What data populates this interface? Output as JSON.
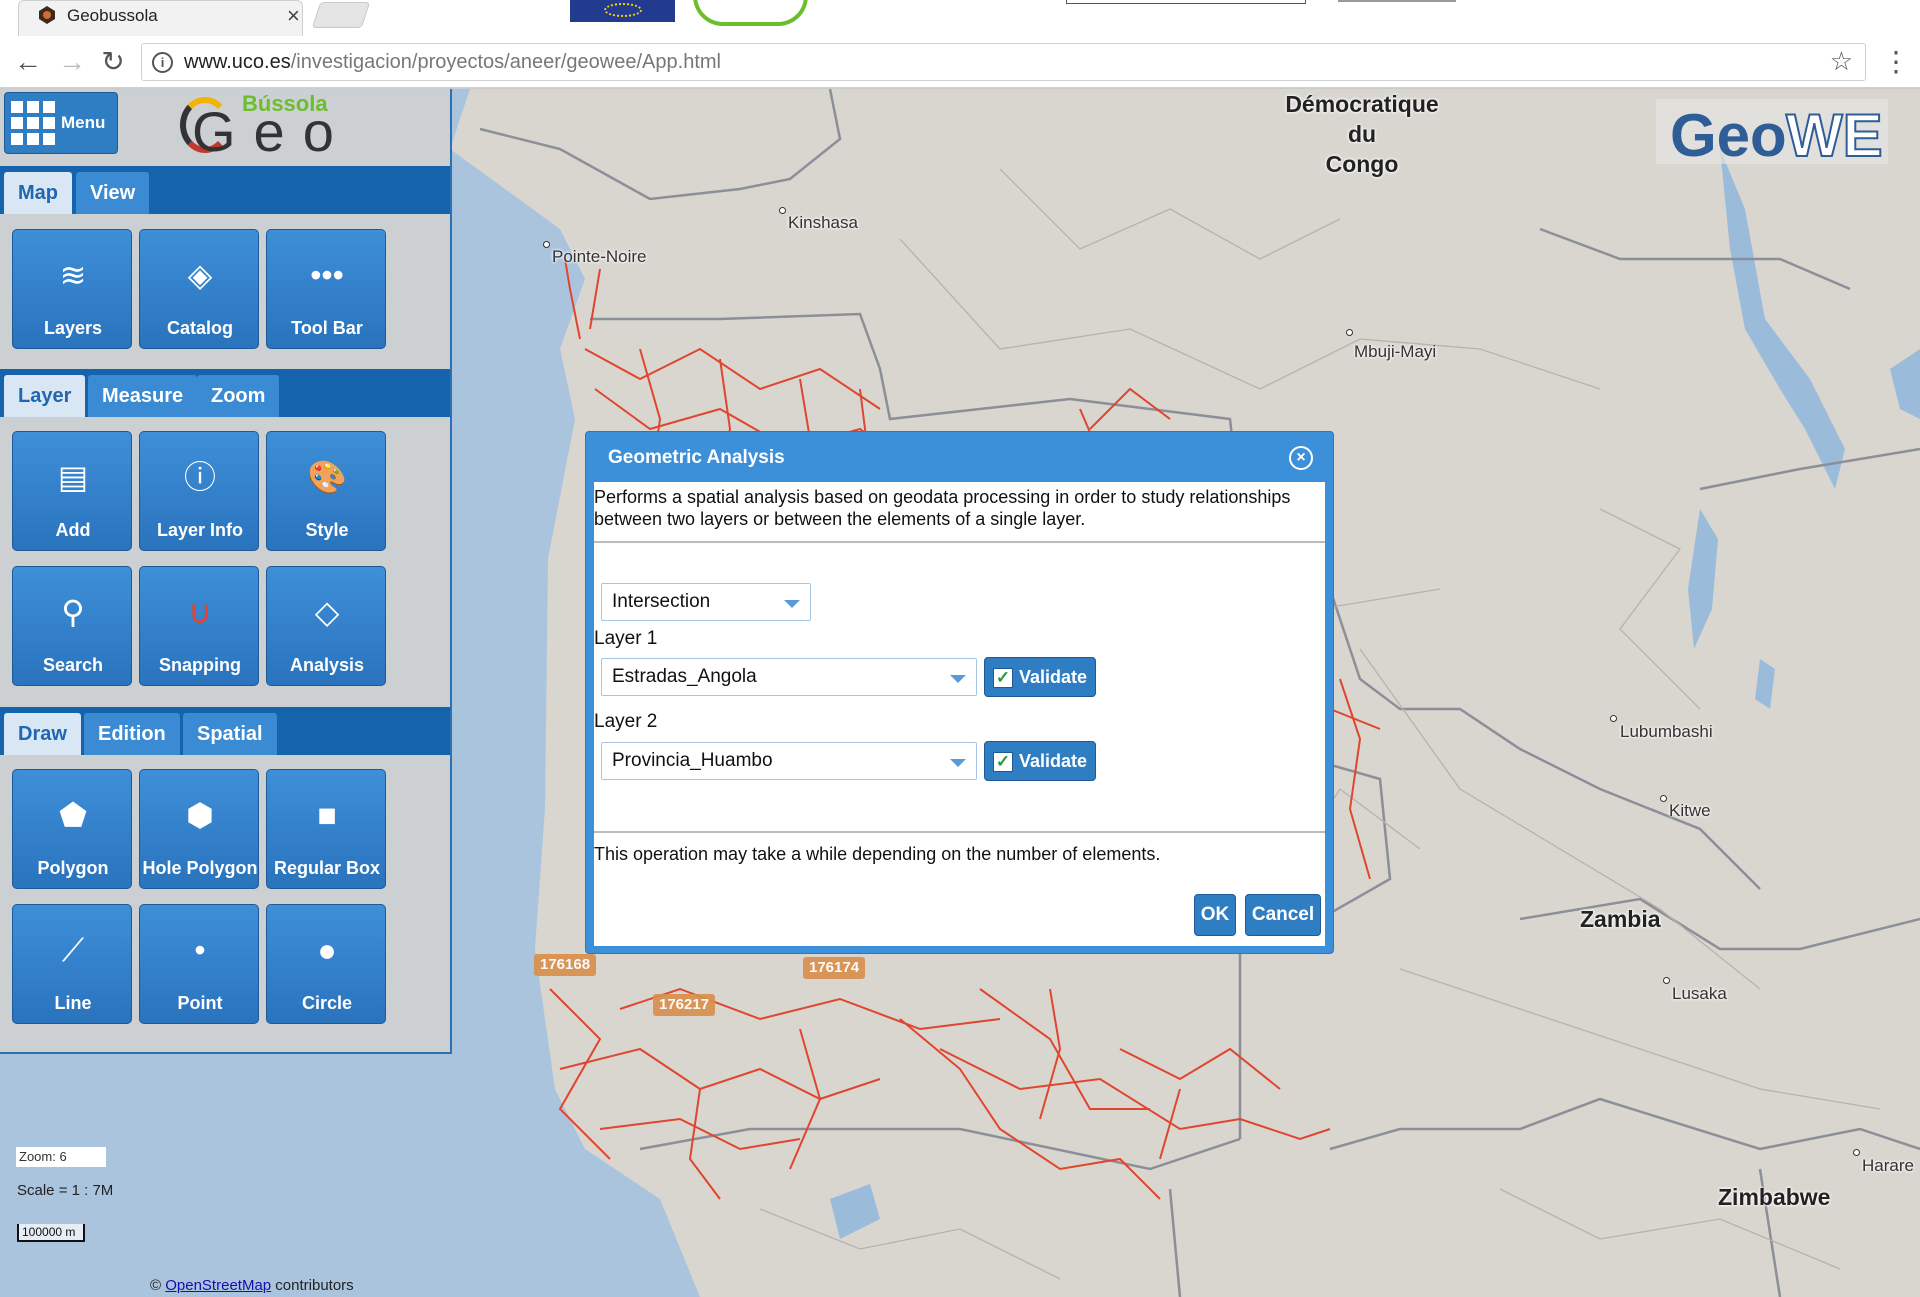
{
  "browser": {
    "tab_title": "Geobussola",
    "tab_close": "×",
    "url_host": "www.uco.es",
    "url_path": "/investigacion/proyectos/aneer/geowee/App.html",
    "info": "i",
    "back": "←",
    "forward": "→",
    "reload": "↻",
    "star": "☆",
    "menu": "⋮"
  },
  "logos": {
    "bussola_top": "Bússola",
    "bussola_main": "Geo",
    "geowe_geo": "Geo",
    "geowe_we": "WE"
  },
  "panel": {
    "menu_label": "Menu",
    "map_tabs": [
      "Map",
      "View"
    ],
    "map_tools": [
      {
        "label": "Layers",
        "icon": "layers-icon",
        "glyph": "≋"
      },
      {
        "label": "Catalog",
        "icon": "catalog-icon",
        "glyph": "◈"
      },
      {
        "label": "Tool Bar",
        "icon": "toolbar-icon",
        "glyph": "•••"
      }
    ],
    "layer_tabs": [
      "Layer",
      "Measure",
      "Zoom"
    ],
    "layer_tools": [
      {
        "label": "Add",
        "icon": "add-layer-icon",
        "glyph": "▤"
      },
      {
        "label": "Layer Info",
        "icon": "info-icon",
        "glyph": "ⓘ"
      },
      {
        "label": "Style",
        "icon": "palette-icon",
        "glyph": "🎨"
      },
      {
        "label": "Search",
        "icon": "binoculars-icon",
        "glyph": "⚲"
      },
      {
        "label": "Snapping",
        "icon": "magnet-icon",
        "glyph": "∪"
      },
      {
        "label": "Analysis",
        "icon": "analysis-icon",
        "glyph": "◇"
      }
    ],
    "draw_tabs": [
      "Draw",
      "Edition",
      "Spatial"
    ],
    "draw_tools": [
      {
        "label": "Polygon",
        "icon": "polygon-icon",
        "glyph": "⬟"
      },
      {
        "label": "Hole Polygon",
        "icon": "hole-polygon-icon",
        "glyph": "⬢"
      },
      {
        "label": "Regular Box",
        "icon": "box-icon",
        "glyph": "■"
      },
      {
        "label": "Line",
        "icon": "line-icon",
        "glyph": "⟋"
      },
      {
        "label": "Point",
        "icon": "point-icon",
        "glyph": "•"
      },
      {
        "label": "Circle",
        "icon": "circle-icon",
        "glyph": "●"
      }
    ]
  },
  "map": {
    "zoom_text": "Zoom: 6",
    "scale_text": "Scale = 1 : 7M",
    "scale_bar": "100000 m",
    "attribution_prefix": "© ",
    "attribution_link": "OpenStreetMap",
    "attribution_suffix": " contributors",
    "countries": {
      "drc": "Démocratique\ndu\nCongo",
      "zambia": "Zambia",
      "zimbabwe": "Zimbabwe"
    },
    "places": {
      "kinshasa": "Kinshasa",
      "pointe_noire": "Pointe-Noire",
      "mbuji_mayi": "Mbuji-Mayi",
      "lubumbashi": "Lubumbashi",
      "kitwe": "Kitwe",
      "lusaka": "Lusaka",
      "harare": "Harare"
    },
    "feature_labels": {
      "a": "176168",
      "b": "176174",
      "c": "176217"
    }
  },
  "dialog": {
    "title": "Geometric Analysis",
    "close": "×",
    "description": "Performs a spatial analysis based on geodata processing in order to study relationships between two layers or between the elements of a single layer.",
    "operation": "Intersection",
    "layer1_label": "Layer 1",
    "layer1_value": "Estradas_Angola",
    "layer2_label": "Layer 2",
    "layer2_value": "Provincia_Huambo",
    "validate_label": "Validate",
    "check": "✓",
    "note": "This operation may take a while depending on the number of elements.",
    "ok_label": "OK",
    "cancel_label": "Cancel"
  },
  "colors": {
    "accent": "#2f7ec4",
    "road": "#e0452e",
    "water": "#9bbbdb"
  }
}
